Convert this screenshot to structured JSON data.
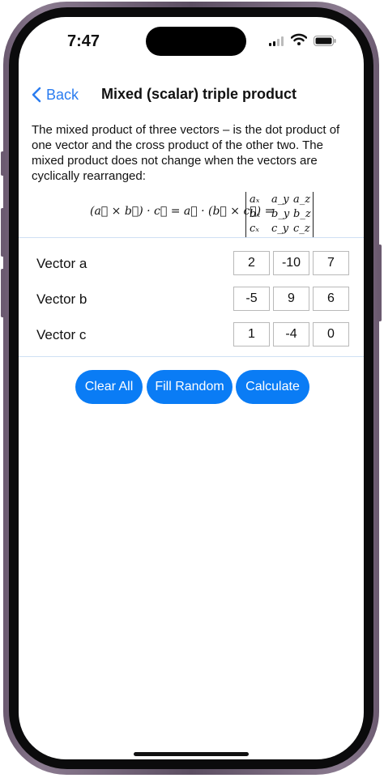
{
  "status": {
    "time": "7:47"
  },
  "nav": {
    "back_label": "Back",
    "title": "Mixed (scalar) triple product"
  },
  "description": "The mixed product of three vectors – is the dot product of one vector and the cross product of the other two. The mixed product does not change when the vectors are cyclically rearranged:",
  "formula": {
    "lhs": "(a⃗ × b⃗) · c⃗ = a⃗ · (b⃗ × c⃗) =",
    "matrix": [
      [
        "aₓ",
        "a_y",
        "a_z"
      ],
      [
        "bₓ",
        "b_y",
        "b_z"
      ],
      [
        "cₓ",
        "c_y",
        "c_z"
      ]
    ]
  },
  "vectors": [
    {
      "label": "Vector a",
      "values": [
        "2",
        "-10",
        "7"
      ]
    },
    {
      "label": "Vector b",
      "values": [
        "-5",
        "9",
        "6"
      ]
    },
    {
      "label": "Vector c",
      "values": [
        "1",
        "-4",
        "0"
      ]
    }
  ],
  "buttons": {
    "clear": "Clear All",
    "random": "Fill Random",
    "calculate": "Calculate"
  },
  "colors": {
    "accent": "#0a7cf5",
    "link": "#2a7cf0",
    "divider": "#cfe0f4"
  }
}
